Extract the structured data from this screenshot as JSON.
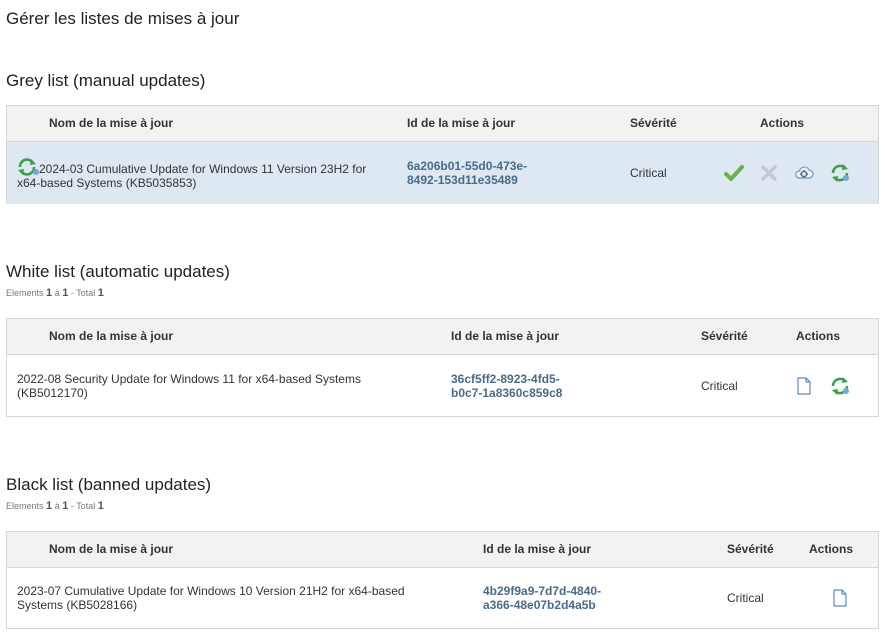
{
  "page_title": "Gérer les listes de mises à jour",
  "columns": {
    "name": "Nom de la mise à jour",
    "id": "Id de la mise à jour",
    "severity": "Sévérité",
    "actions": "Actions"
  },
  "grey_list": {
    "title": "Grey list (manual updates)",
    "rows": [
      {
        "name": "2024-03 Cumulative Update for Windows 11 Version 23H2 for x64-based Systems (KB5035853)",
        "id_line1": "6a206b01-55d0-473e-",
        "id_line2": "8492-153d11e35489",
        "severity": "Critical",
        "actions": [
          "approve-icon",
          "reject-icon",
          "cloud-settings-icon",
          "refresh-icon"
        ]
      }
    ]
  },
  "white_list": {
    "title": "White list (automatic updates)",
    "pager": {
      "prefix": "Elements",
      "from": "1",
      "sep": "à",
      "to": "1",
      "total_label": "- Total",
      "total": "1"
    },
    "rows": [
      {
        "name": "2022-08 Security Update for Windows 11 for x64-based Systems (KB5012170)",
        "id_line1": "36cf5ff2-8923-4fd5-",
        "id_line2": "b0c7-1a8360c859c8",
        "severity": "Critical",
        "actions": [
          "document-icon",
          "refresh-icon"
        ]
      }
    ]
  },
  "black_list": {
    "title": "Black list (banned updates)",
    "pager": {
      "prefix": "Elements",
      "from": "1",
      "sep": "à",
      "to": "1",
      "total_label": "- Total",
      "total": "1"
    },
    "rows": [
      {
        "name": "2023-07 Cumulative Update for Windows 10 Version 21H2 for x64-based Systems (KB5028166)",
        "id_line1": "4b29f9a9-7d7d-4840-",
        "id_line2": "a366-48e07b2d4a5b",
        "severity": "Critical",
        "actions": [
          "document-icon"
        ]
      }
    ]
  },
  "colors": {
    "header_bg": "#f2f2f2",
    "selected_row_bg": "#dde8f3",
    "id_text": "#4a6a8a",
    "approve_green": "#6ab04c",
    "refresh_green": "#3aa04a"
  }
}
